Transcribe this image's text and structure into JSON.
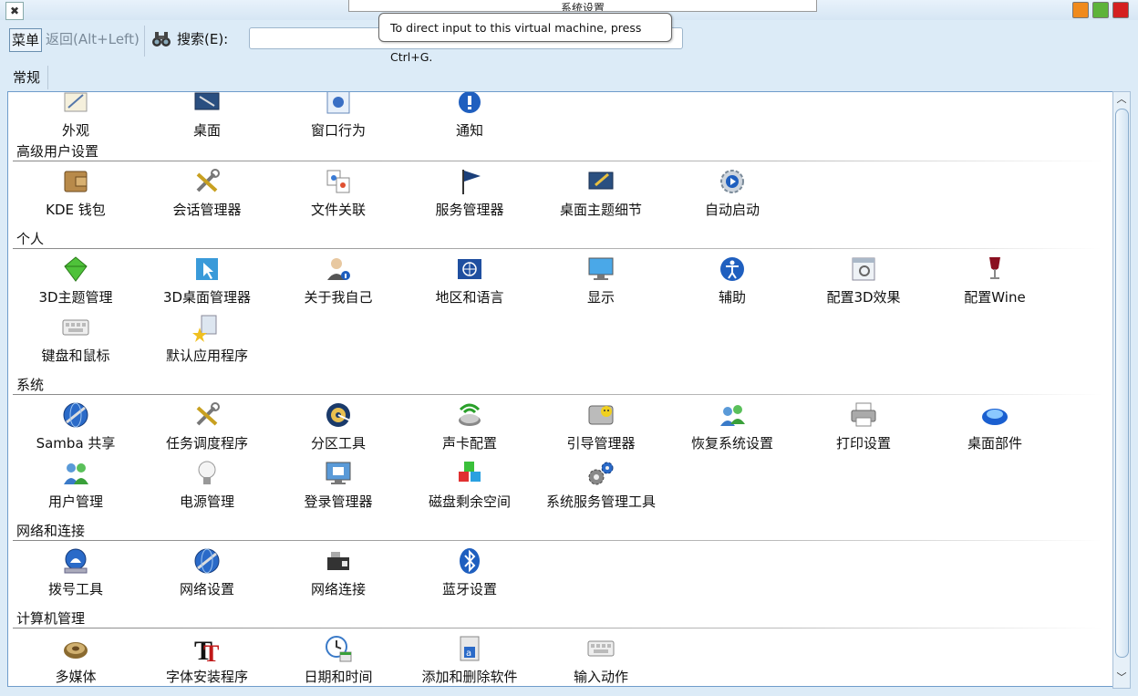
{
  "window": {
    "title": "系统设置",
    "controls": {
      "minimize_color": "#f08a1c",
      "maximize_color": "#5db33a",
      "close_color": "#d42020"
    }
  },
  "toolbar": {
    "menu_label": "菜单",
    "back_label": "返回(Alt+Left)",
    "search_label": "搜索(E):",
    "search_value": ""
  },
  "tooltip": {
    "text": "To direct input to this virtual machine, press Ctrl+G."
  },
  "tabs": [
    {
      "label": "常规"
    }
  ],
  "top_row": {
    "items": [
      {
        "label": "外观",
        "icon": "appearance-icon"
      },
      {
        "label": "桌面",
        "icon": "desktop-icon"
      },
      {
        "label": "窗口行为",
        "icon": "window-behavior-icon"
      },
      {
        "label": "通知",
        "icon": "notification-icon"
      }
    ]
  },
  "sections": [
    {
      "title": "高级用户设置",
      "items": [
        {
          "label": "KDE 钱包",
          "icon": "wallet-icon"
        },
        {
          "label": "会话管理器",
          "icon": "tools-icon"
        },
        {
          "label": "文件关联",
          "icon": "file-association-icon"
        },
        {
          "label": "服务管理器",
          "icon": "flag-icon"
        },
        {
          "label": "桌面主题细节",
          "icon": "desktop-theme-icon"
        },
        {
          "label": "自动启动",
          "icon": "autostart-gear-icon"
        }
      ]
    },
    {
      "title": "个人",
      "items": [
        {
          "label": "3D主题管理",
          "icon": "gem-icon"
        },
        {
          "label": "3D桌面管理器",
          "icon": "cursor-icon"
        },
        {
          "label": "关于我自己",
          "icon": "user-info-icon"
        },
        {
          "label": "地区和语言",
          "icon": "globe-flag-icon"
        },
        {
          "label": "显示",
          "icon": "monitor-icon"
        },
        {
          "label": "辅助",
          "icon": "accessibility-icon"
        },
        {
          "label": "配置3D效果",
          "icon": "effects-window-icon"
        },
        {
          "label": "配置Wine",
          "icon": "wine-glass-icon"
        },
        {
          "label": "键盘和鼠标",
          "icon": "keyboard-icon"
        },
        {
          "label": "默认应用程序",
          "icon": "default-apps-icon"
        }
      ]
    },
    {
      "title": "系统",
      "items": [
        {
          "label": "Samba 共享",
          "icon": "samba-globe-icon"
        },
        {
          "label": "任务调度程序",
          "icon": "tools-icon"
        },
        {
          "label": "分区工具",
          "icon": "partition-icon"
        },
        {
          "label": "声卡配置",
          "icon": "speaker-icon"
        },
        {
          "label": "引导管理器",
          "icon": "disk-boot-icon"
        },
        {
          "label": "恢复系统设置",
          "icon": "users-restore-icon"
        },
        {
          "label": "打印设置",
          "icon": "printer-icon"
        },
        {
          "label": "桌面部件",
          "icon": "plasma-orb-icon"
        },
        {
          "label": "用户管理",
          "icon": "users-icon"
        },
        {
          "label": "电源管理",
          "icon": "bulb-icon"
        },
        {
          "label": "登录管理器",
          "icon": "login-screen-icon"
        },
        {
          "label": "磁盘剩余空间",
          "icon": "cubes-icon"
        },
        {
          "label": "系统服务管理工具",
          "icon": "gears-icon"
        }
      ]
    },
    {
      "title": "网络和连接",
      "items": [
        {
          "label": "拨号工具",
          "icon": "dialup-icon"
        },
        {
          "label": "网络设置",
          "icon": "network-globe-icon"
        },
        {
          "label": "网络连接",
          "icon": "network-card-icon"
        },
        {
          "label": "蓝牙设置",
          "icon": "bluetooth-icon"
        }
      ]
    },
    {
      "title": "计算机管理",
      "items": [
        {
          "label": "多媒体",
          "icon": "multimedia-icon"
        },
        {
          "label": "字体安装程序",
          "icon": "font-icon"
        },
        {
          "label": "日期和时间",
          "icon": "clock-icon"
        },
        {
          "label": "添加和删除软件",
          "icon": "package-icon"
        },
        {
          "label": "输入动作",
          "icon": "keyboard-icon"
        }
      ]
    }
  ],
  "scrollbar": {
    "position_fraction": 0.95
  }
}
